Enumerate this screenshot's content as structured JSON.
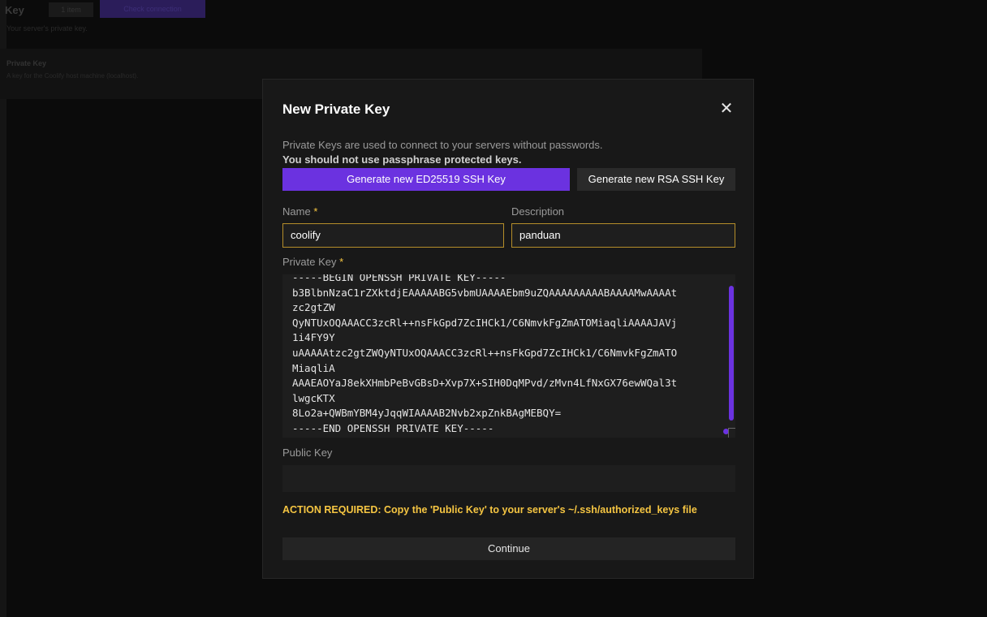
{
  "background": {
    "title": "Key",
    "badge": "1 item",
    "primary_button": "Check connection",
    "subtitle": "Your server's private key.",
    "card_title": "Private Key",
    "card_subtitle": "A key for the Coolify host machine (localhost)."
  },
  "modal": {
    "title": "New Private Key",
    "close_icon": "close-icon",
    "intro": "Private Keys are used to connect to your servers without passwords.",
    "warning": "You should not use passphrase protected keys.",
    "generate_ed25519_label": "Generate new ED25519 SSH Key",
    "generate_rsa_label": "Generate new RSA SSH Key",
    "name_label": "Name",
    "required_mark": "*",
    "name_value": "coolify",
    "description_label": "Description",
    "description_value": "panduan",
    "private_key_label": "Private Key",
    "private_key_value": "-----BEGIN OPENSSH PRIVATE KEY-----\nb3BlbnNzaC1rZXktdjEAAAAABG5vbmUAAAAEbm9uZQAAAAAAAAABAAAAMwAAAAt\nzc2gtZW\nQyNTUxOQAAACC3zcRl++nsFkGpd7ZcIHCk1/C6NmvkFgZmATOMiaqliAAAAJAVj\n1i4FY9Y\nuAAAAAtzc2gtZWQyNTUxOQAAACC3zcRl++nsFkGpd7ZcIHCk1/C6NmvkFgZmATO\nMiaqliA\nAAAEAOYaJ8ekXHmbPeBvGBsD+Xvp7X+SIH0DqMPvd/zMvn4LfNxGX76ewWQal3t\nlwgcKTX\n8Lo2a+QWBmYBM4yJqqWIAAAAB2Nvb2xpZnkBAgMEBQY=\n-----END OPENSSH PRIVATE KEY-----",
    "public_key_label": "Public Key",
    "public_key_value": "",
    "action_required": "ACTION REQUIRED: Copy the 'Public Key' to your server's ~/.ssh/authorized_keys file",
    "continue_label": "Continue"
  },
  "colors": {
    "accent": "#6b32e0",
    "warning": "#f5c542",
    "modal_bg": "#181818"
  }
}
